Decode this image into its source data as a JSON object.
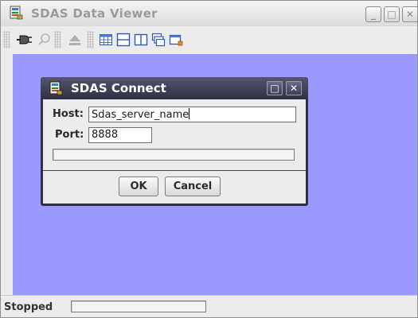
{
  "window": {
    "title": "SDAS Data Viewer",
    "minimize_glyph": "_",
    "maximize_glyph": "□",
    "close_glyph": "✕"
  },
  "toolbar": {
    "icons": [
      "connect-plug-icon",
      "search-icon",
      "eject-icon",
      "table-view-icon",
      "split-horizontal-icon",
      "split-vertical-icon",
      "cascade-windows-icon",
      "new-window-icon"
    ]
  },
  "dialog": {
    "title": "SDAS Connect",
    "maximize_glyph": "□",
    "close_glyph": "✕",
    "host_label": "Host:",
    "host_value": "Sdas_server_name",
    "port_label": "Port:",
    "port_value": "8888",
    "ok_label": "OK",
    "cancel_label": "Cancel",
    "progress": 0
  },
  "statusbar": {
    "status_text": "Stopped",
    "progress": 0
  },
  "colors": {
    "desktop_background": "#9999ff",
    "dialog_titlebar": "#2f2f45"
  }
}
